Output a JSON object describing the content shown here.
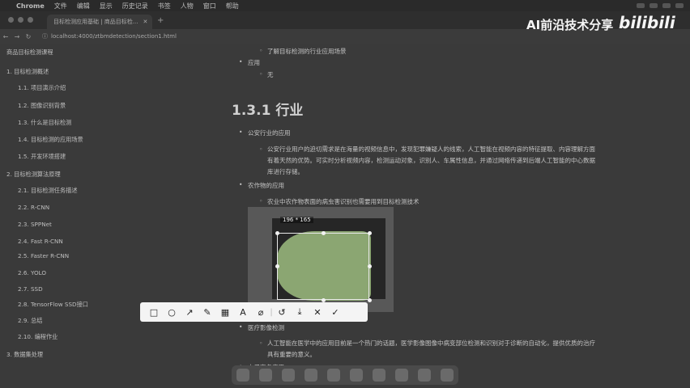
{
  "menubar": {
    "app": "Chrome",
    "items": [
      "文件",
      "编辑",
      "显示",
      "历史记录",
      "书签",
      "人物",
      "窗口",
      "帮助"
    ]
  },
  "tab": {
    "title": "目标检测应用基础 | 商品目标检..."
  },
  "address": {
    "url": "localhost:4000/ztbmdetection/section1.html"
  },
  "sidebar": {
    "title": "商品目标检测课程",
    "items": [
      "1. 目标检测概述",
      "1.1. 项目演示介绍",
      "1.2. 图像识别背景",
      "1.3. 什么是目标检测",
      "1.4. 目标检测的应用场景",
      "1.5. 开发环境搭建",
      "2. 目标检测算法原理",
      "2.1. 目标检测任务描述",
      "2.2. R-CNN",
      "2.3. SPPNet",
      "2.4. Fast R-CNN",
      "2.5. Faster R-CNN",
      "2.6. YOLO",
      "2.7. SSD",
      "2.8. TensorFlow SSD接口",
      "2.9. 总结",
      "2.10. 编程作业",
      "3. 数据集处理"
    ]
  },
  "content": {
    "line1": "了解目标检测的行业应用场景",
    "line2": "应用",
    "line3": "无",
    "heading": "1.3.1 行业",
    "b1": "公安行业的应用",
    "p1": "公安行业用户的迫切需求是在海量的视频信息中，发现犯罪嫌疑人的线索，人工智能在视频内容的特征提取、内容理解方面有着天然的优势。可实时分析视频内容，检测运动对象，识别人、车属性信息，并通过网络传递到后端人工智能的中心数据库进行存储。",
    "b2": "农作物的应用",
    "p2": "农业中农作物表面的病虫害识别也需要用到目标检测技术",
    "b3": "医疗影像检测",
    "p3": "人工智能在医学中的应用目前是一个热门的话题，医学影像图像中病变部位检测和识别对于诊断的自动化，提供优质的治疗具有重要的意义。",
    "b4": "电子商务应用"
  },
  "screenshot": {
    "dimensions": "196 * 165"
  },
  "toolbar": {
    "tools": [
      {
        "name": "rectangle-icon",
        "glyph": "□"
      },
      {
        "name": "ellipse-icon",
        "glyph": "○"
      },
      {
        "name": "arrow-icon",
        "glyph": "↗"
      },
      {
        "name": "pen-icon",
        "glyph": "✎"
      },
      {
        "name": "mosaic-icon",
        "glyph": "▦"
      },
      {
        "name": "text-icon",
        "glyph": "A"
      },
      {
        "name": "marker-icon",
        "glyph": "⌀"
      },
      {
        "name": "divider",
        "glyph": "|"
      },
      {
        "name": "undo-icon",
        "glyph": "↺"
      },
      {
        "name": "download-icon",
        "glyph": "⤓"
      },
      {
        "name": "close-icon",
        "glyph": "✕"
      },
      {
        "name": "confirm-icon",
        "glyph": "✓"
      }
    ]
  },
  "watermark": {
    "text": "AI前沿技术分享",
    "logo": "bilibili"
  }
}
